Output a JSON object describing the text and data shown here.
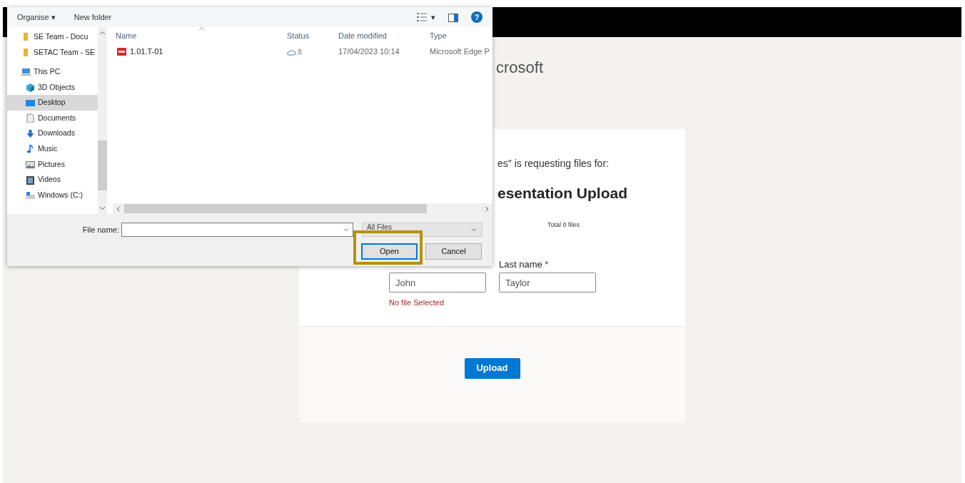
{
  "page": {
    "brand": "crosoft",
    "request_text": "es\" is requesting files for:",
    "title": "esentation Upload",
    "total": "Total 0 files",
    "first_name": {
      "value": "John",
      "error": "No file Selected"
    },
    "last_name": {
      "label": "Last name",
      "required_mark": "*",
      "value": "Taylor"
    },
    "upload_button": "Upload"
  },
  "dialog": {
    "toolbar": {
      "organise": "Organise",
      "organise_caret": "▾",
      "new_folder": "New folder",
      "view_caret": "▾",
      "help": "?"
    },
    "nav": [
      {
        "label": "SE Team - Docu",
        "kind": "folder",
        "selected": false
      },
      {
        "label": "SETAC Team - SE",
        "kind": "folder",
        "selected": false
      },
      {
        "label": "This PC",
        "kind": "pc",
        "selected": false,
        "children": [
          {
            "label": "3D Objects",
            "kind": "cube",
            "selected": false
          },
          {
            "label": "Desktop",
            "kind": "desktop",
            "selected": true
          },
          {
            "label": "Documents",
            "kind": "document",
            "selected": false
          },
          {
            "label": "Downloads",
            "kind": "download",
            "selected": false
          },
          {
            "label": "Music",
            "kind": "music",
            "selected": false
          },
          {
            "label": "Pictures",
            "kind": "picture",
            "selected": false
          },
          {
            "label": "Videos",
            "kind": "video",
            "selected": false
          },
          {
            "label": "Windows  (C:)",
            "kind": "drive",
            "selected": false
          }
        ]
      }
    ],
    "columns": [
      {
        "label": "Name",
        "sorted": true
      },
      {
        "label": "Status",
        "sorted": false
      },
      {
        "label": "Date modified",
        "sorted": false
      },
      {
        "label": "Type",
        "sorted": false
      }
    ],
    "files": [
      {
        "name": "1.01.T-01",
        "date": "17/04/2023 10:14",
        "type": "Microsoft Edge P"
      }
    ],
    "file_name_label": "File name:",
    "filter": "All Files",
    "buttons": [
      {
        "label": "Open",
        "highlighted": true
      },
      {
        "label": "Cancel",
        "highlighted": false
      }
    ]
  }
}
